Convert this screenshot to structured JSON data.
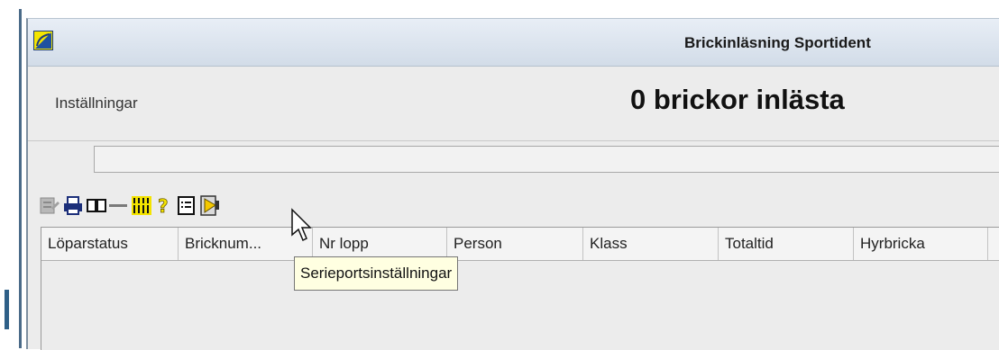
{
  "window": {
    "title": "Brickinläsning Sportident"
  },
  "header": {
    "settings_label": "Inställningar",
    "count_label": "0 brickor inlästa"
  },
  "toolbar": {
    "buttons": [
      {
        "icon": "edit-document-icon",
        "enabled": false
      },
      {
        "icon": "printer-icon"
      },
      {
        "icon": "open-book-icon"
      },
      {
        "icon": "minus-icon"
      },
      {
        "icon": "timing-columns-icon"
      },
      {
        "icon": "help-icon"
      },
      {
        "icon": "list-document-icon"
      },
      {
        "icon": "serial-port-settings-icon"
      }
    ]
  },
  "table": {
    "columns": [
      "Löparstatus",
      "Bricknum...",
      "Nr lopp",
      "Person",
      "Klass",
      "Totaltid",
      "Hyrbricka"
    ],
    "rows": []
  },
  "tooltip": {
    "text": "Serieportsinställningar"
  },
  "colors": {
    "tooltip_bg": "#ffffe1",
    "app_icon_yellow": "#f4e400",
    "titlebar": "#d8e2ee"
  }
}
